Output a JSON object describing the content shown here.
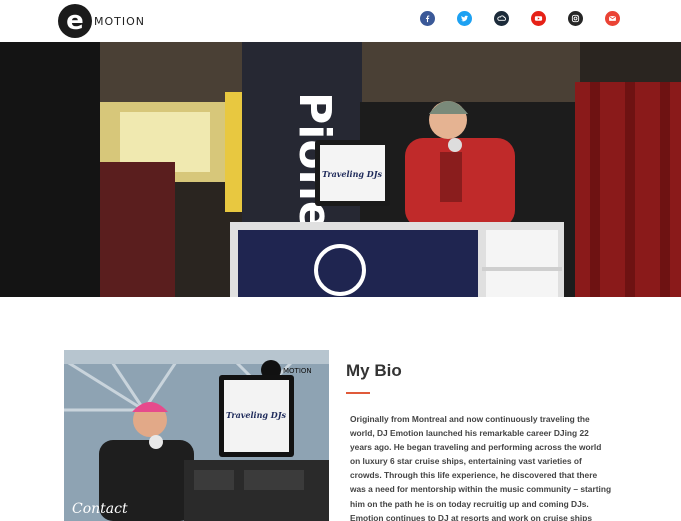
{
  "header": {
    "logo_letter": "e",
    "logo_text": "MOTION",
    "social": [
      {
        "name": "facebook",
        "icon": "facebook-icon",
        "color": "#3b5998"
      },
      {
        "name": "twitter",
        "icon": "twitter-icon",
        "color": "#1da1f2"
      },
      {
        "name": "soundcloud",
        "icon": "soundcloud-icon",
        "color": "#1c2b3a"
      },
      {
        "name": "youtube",
        "icon": "youtube-icon",
        "color": "#e62117"
      },
      {
        "name": "instagram",
        "icon": "instagram-icon",
        "color": "#262626"
      },
      {
        "name": "email",
        "icon": "email-icon",
        "color": "#ea4335"
      }
    ]
  },
  "hero": {
    "banner_text": "Pioneer",
    "laptop_text": "Traveling DJs"
  },
  "bio": {
    "photo_logo_text": "MOTION",
    "photo_laptop_text": "Traveling DJs",
    "photo_caption": "Contact",
    "title": "My Bio",
    "text": "Originally from Montreal and now continuously traveling the world, DJ Emotion launched his remarkable career DJing 22 years ago. He began traveling and performing across the world on luxury 6 star cruise ships, entertaining vast varieties of crowds. Through this life experience, he discovered that there was a need for mentorship within the music community – starting him on the path he is on today recruitig up and coming DJs. Emotion continues to DJ at resorts and work on cruise ships"
  },
  "colors": {
    "accent": "#e05a3a"
  }
}
